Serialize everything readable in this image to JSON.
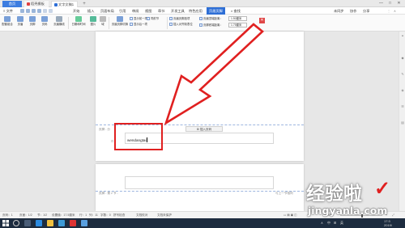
{
  "titlebar": {
    "tabs": [
      {
        "label": "首页"
      },
      {
        "label": "稻壳模板"
      },
      {
        "label": "文字文稿1"
      }
    ],
    "add_tab": "+",
    "window_controls": {
      "minimize": "—",
      "maximize": "□",
      "close": "✕"
    }
  },
  "menubar": {
    "file": "文件",
    "items": [
      "开始",
      "插入",
      "页面布局",
      "引用",
      "审阅",
      "视图",
      "章节",
      "开发工具",
      "特色应用",
      "页眉页脚"
    ],
    "active_index": 9,
    "search": "查找",
    "right": [
      "未同步",
      "协作",
      "分享"
    ]
  },
  "ribbon": {
    "buttons": [
      {
        "label": "配套组合",
        "icon": "combo-icon"
      },
      {
        "label": "页眉",
        "icon": "header-icon"
      },
      {
        "label": "页脚",
        "icon": "footer-icon"
      },
      {
        "label": "页码",
        "icon": "page-number-icon"
      },
      {
        "label": "页眉横线",
        "icon": "header-line-icon"
      },
      {
        "label": "日期和时间",
        "icon": "datetime-icon"
      },
      {
        "label": "图片",
        "icon": "picture-icon"
      },
      {
        "label": "域",
        "icon": "field-icon"
      },
      {
        "label": "页眉页脚切换",
        "icon": "switch-icon"
      }
    ],
    "nav": {
      "prev": "显示前一项",
      "next": "显示后一项",
      "same_prev": "同前节"
    },
    "options": {
      "odd_even": "页眉页脚选项",
      "insert_align": "插入对齐制表位",
      "top_distance_label": "页眉顶端距离：",
      "top_distance_value": "1.50厘米",
      "bottom_distance_label": "页脚底端距离：",
      "bottom_distance_value": "1.75厘米"
    },
    "close": "✕"
  },
  "document": {
    "footer_label": "页脚 - 分",
    "insert_page_number": "插入页码",
    "footer_text": "wendangtai",
    "page2_footer_label": "页脚 - 第 2 节 -",
    "page2_same_as_prev": "与上一节相同"
  },
  "statusbar": {
    "items": [
      "页码：1",
      "页面：1/2",
      "节：1/2",
      "设置值：17.5厘米",
      "行：1",
      "列：11",
      "字数：0",
      "拼写检查",
      "文档校对",
      "文档未保护"
    ],
    "zoom": "100%"
  },
  "taskbar": {
    "tray": [
      "∧",
      "中",
      "⊞",
      "英",
      "17:3",
      "2019/"
    ]
  },
  "watermark": {
    "main": "经验啦",
    "check": "✓",
    "sub": "jingyanla.com"
  },
  "colors": {
    "accent": "#2e6fd6",
    "annotation": "#e02020",
    "taskbar": "#1d2c3f"
  }
}
